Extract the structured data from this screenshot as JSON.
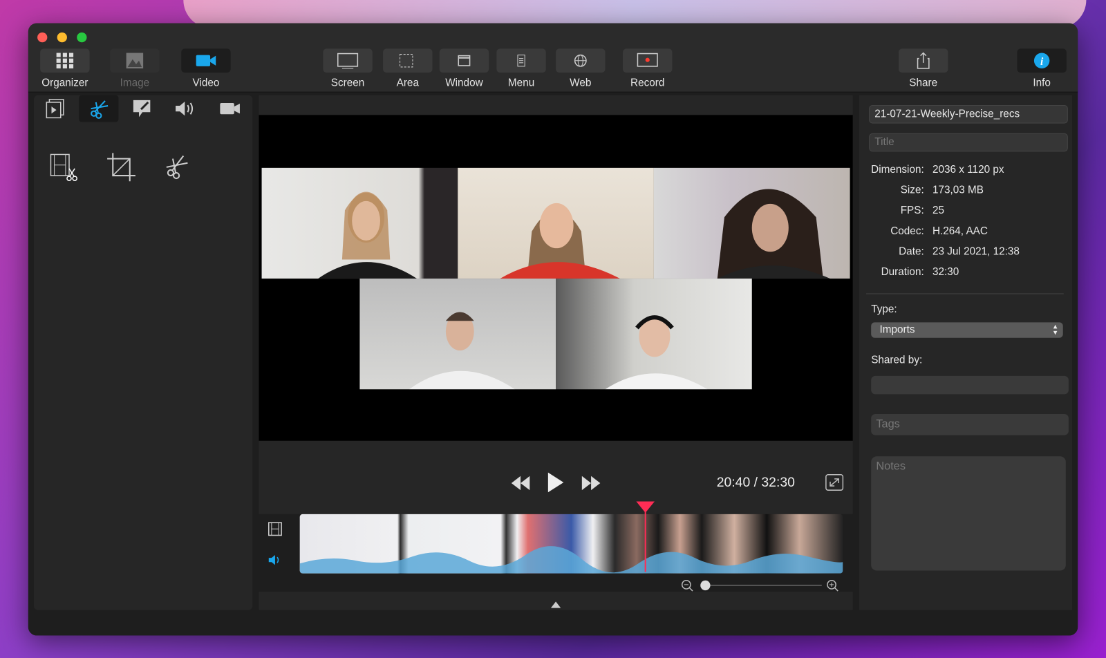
{
  "toolbar": {
    "left": [
      {
        "label": "Organizer",
        "icon": "grid-icon"
      },
      {
        "label": "Image",
        "icon": "image-icon",
        "disabled": true
      },
      {
        "label": "Video",
        "icon": "video-camera-icon",
        "active": true
      }
    ],
    "capture": [
      {
        "label": "Screen",
        "icon": "screen-icon"
      },
      {
        "label": "Area",
        "icon": "area-icon"
      },
      {
        "label": "Window",
        "icon": "window-icon"
      },
      {
        "label": "Menu",
        "icon": "menu-icon"
      },
      {
        "label": "Web",
        "icon": "globe-icon"
      },
      {
        "label": "Record",
        "icon": "record-icon"
      }
    ],
    "share": {
      "label": "Share",
      "icon": "share-icon"
    },
    "info": {
      "label": "Info",
      "icon": "info-icon"
    }
  },
  "edit_tabs": [
    "preview",
    "trim",
    "annotate",
    "audio",
    "camera"
  ],
  "edit_tools": [
    "trim-clip",
    "crop",
    "cut"
  ],
  "player": {
    "current_time": "20:40",
    "duration": "32:30",
    "time_display": "20:40 / 32:30",
    "progress_fraction": 0.636
  },
  "info": {
    "filename": "21-07-21-Weekly-Precise_recs",
    "title_placeholder": "Title",
    "details": [
      {
        "key": "Dimension:",
        "value": "2036 x 1120 px"
      },
      {
        "key": "Size:",
        "value": "173,03 MB"
      },
      {
        "key": "FPS:",
        "value": "25"
      },
      {
        "key": "Codec:",
        "value": "H.264, AAC"
      },
      {
        "key": "Date:",
        "value": "23 Jul 2021, 12:38"
      },
      {
        "key": "Duration:",
        "value": "32:30"
      }
    ],
    "type_label": "Type:",
    "type_value": "Imports",
    "shared_by_label": "Shared by:",
    "shared_by_value": "",
    "tags_placeholder": "Tags",
    "notes_placeholder": "Notes"
  },
  "colors": {
    "accent": "#1aa7ec",
    "playhead": "#ff2d55",
    "close": "#ff5f57",
    "minimize": "#febc2e",
    "zoom": "#28c840"
  }
}
